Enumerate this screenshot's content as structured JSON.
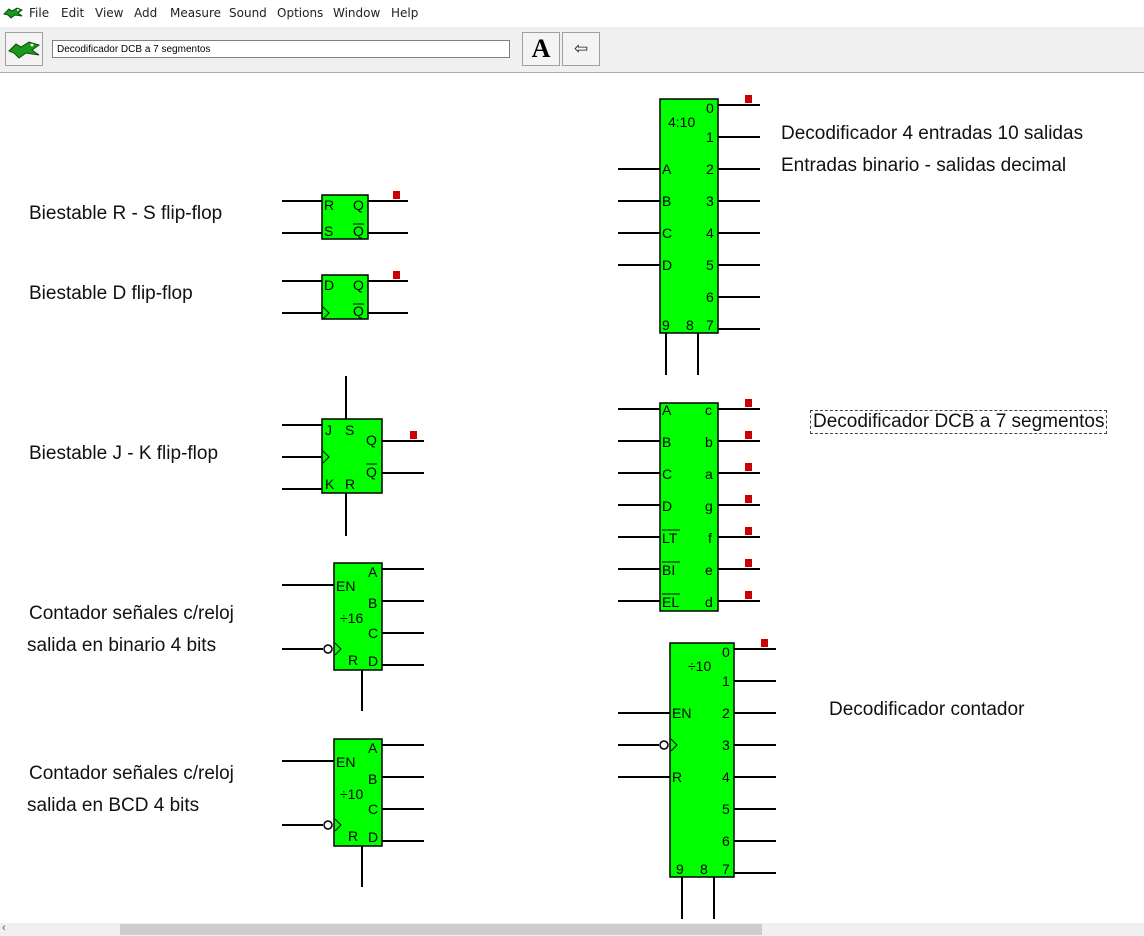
{
  "menu": {
    "items": [
      "File",
      "Edit",
      "View",
      "Add",
      "Measure",
      "Sound",
      "Options",
      "Window",
      "Help"
    ]
  },
  "toolbar": {
    "title_value": "Decodificador DCB a 7 segmentos",
    "font_button_label": "A",
    "back_button_label": "⇦"
  },
  "labels": {
    "rs": "Biestable R - S  flip-flop",
    "d": "Biestable D flip-flop",
    "jk": "Biestable J - K flip-flop",
    "counter16_line1": "Contador señales c/reloj",
    "counter16_line2": "salida en binario 4 bits",
    "counter10_line1": "Contador señales c/reloj",
    "counter10_line2": "salida en BCD 4 bits",
    "dec410_line1": "Decodificador 4 entradas 10 salidas",
    "dec410_line2": "Entradas binario - salidas decimal",
    "dcb7": "Decodificador DCB a 7 segmentos",
    "decounter": "Decodificador contador"
  },
  "chips": {
    "rs": {
      "pins": [
        "R",
        "S",
        "Q",
        "Q"
      ]
    },
    "d": {
      "pins": [
        "D",
        "Q",
        "Q"
      ]
    },
    "jk": {
      "pins": [
        "J",
        "S",
        "K",
        "R",
        "Q",
        "Q"
      ]
    },
    "counter16": {
      "title": "÷16",
      "pins": [
        "EN",
        "R",
        "A",
        "B",
        "C",
        "D"
      ]
    },
    "counter10": {
      "title": "÷10",
      "pins": [
        "EN",
        "R",
        "A",
        "B",
        "C",
        "D"
      ]
    },
    "dec410": {
      "title": "4:10",
      "inputs": [
        "A",
        "B",
        "C",
        "D"
      ],
      "outputs": [
        "0",
        "1",
        "2",
        "3",
        "4",
        "5",
        "6",
        "7"
      ],
      "bottom": [
        "9",
        "8"
      ]
    },
    "dcb7": {
      "inputs": [
        "A",
        "B",
        "C",
        "D",
        "LT",
        "BI",
        "EL"
      ],
      "outputs": [
        "c",
        "b",
        "a",
        "g",
        "f",
        "e",
        "d"
      ]
    },
    "decounter": {
      "title": "÷10",
      "inputs": [
        "EN",
        "R"
      ],
      "outputs": [
        "0",
        "1",
        "2",
        "3",
        "4",
        "5",
        "6",
        "7"
      ],
      "bottom": [
        "9",
        "8"
      ]
    }
  },
  "colors": {
    "chip_fill": "#00ff00",
    "chip_border": "#000000",
    "led": "#cc0000",
    "wire": "#000000"
  }
}
